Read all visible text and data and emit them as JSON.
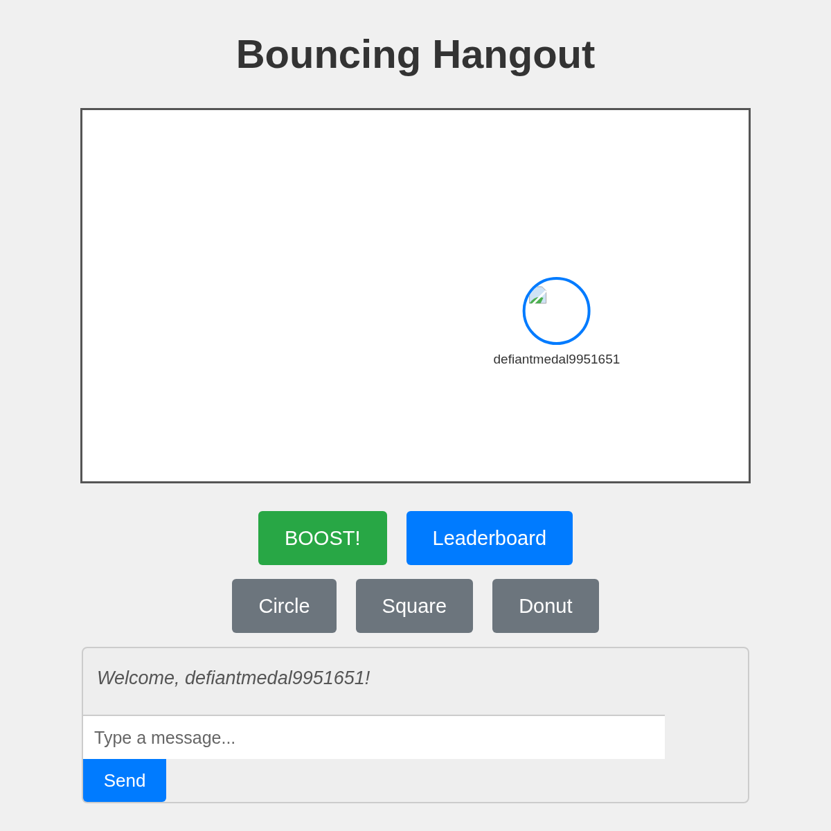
{
  "title": "Bouncing Hangout",
  "canvas": {
    "players": [
      {
        "name": "defiantmedal9951651"
      }
    ]
  },
  "actions": [
    {
      "label": "BOOST!",
      "kind": "success"
    },
    {
      "label": "Leaderboard",
      "kind": "primary"
    }
  ],
  "shapes": [
    "Circle",
    "Square",
    "Donut"
  ],
  "chat": {
    "messages": [
      {
        "text": "Welcome, defiantmedal9951651!",
        "kind": "system"
      }
    ],
    "input": {
      "placeholder": "Type a message..."
    },
    "send": "Send"
  }
}
